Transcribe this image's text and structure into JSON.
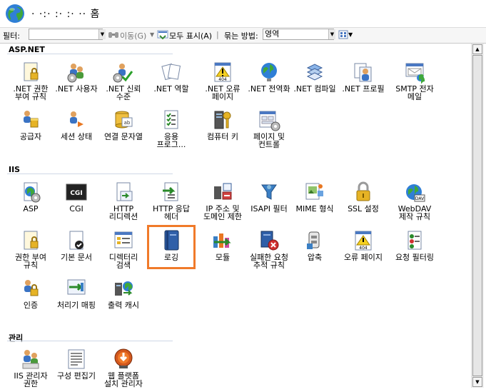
{
  "window": {
    "title": "· ·:· :· :· ·· 홈"
  },
  "toolbar": {
    "filter_label": "필터:",
    "goto_label": "이동(G)",
    "show_all_label": "모두 표시(A)",
    "group_by_label": "묶는 방법:",
    "group_by_value": "영역"
  },
  "sections": [
    {
      "title": "ASP.NET",
      "items": [
        {
          "label": ".NET 권한\n부여 규칙",
          "icon": "net-authorization-icon"
        },
        {
          "label": ".NET 사용자",
          "icon": "net-users-icon"
        },
        {
          "label": ".NET 신뢰\n수준",
          "icon": "net-trust-icon"
        },
        {
          "label": ".NET 역할",
          "icon": "net-roles-icon"
        },
        {
          "label": ".NET 오류\n페이지",
          "icon": "net-error-pages-icon"
        },
        {
          "label": ".NET 전역화",
          "icon": "net-globalization-icon"
        },
        {
          "label": ".NET 컴파일",
          "icon": "net-compilation-icon"
        },
        {
          "label": ".NET 프로필",
          "icon": "net-profile-icon"
        },
        {
          "label": "SMTP 전자\n메일",
          "icon": "smtp-email-icon"
        },
        {
          "label": "공급자",
          "icon": "providers-icon"
        },
        {
          "label": "세션 상태",
          "icon": "session-state-icon"
        },
        {
          "label": "연결 문자열",
          "icon": "connection-strings-icon"
        },
        {
          "label": "응용\n프로그...",
          "icon": "app-settings-icon"
        },
        {
          "label": "컴퓨터 키",
          "icon": "machine-key-icon"
        },
        {
          "label": "페이지 및\n컨트롤",
          "icon": "pages-controls-icon"
        }
      ]
    },
    {
      "title": "IIS",
      "items": [
        {
          "label": "ASP",
          "icon": "asp-icon"
        },
        {
          "label": "CGI",
          "icon": "cgi-icon"
        },
        {
          "label": "HTTP\n리디렉션",
          "icon": "http-redirect-icon"
        },
        {
          "label": "HTTP 응답\n헤더",
          "icon": "http-response-headers-icon"
        },
        {
          "label": "IP 주소 및\n도메인 제한",
          "icon": "ip-domain-restrictions-icon"
        },
        {
          "label": "ISAPI 필터",
          "icon": "isapi-filters-icon"
        },
        {
          "label": "MIME 형식",
          "icon": "mime-types-icon"
        },
        {
          "label": "SSL 설정",
          "icon": "ssl-settings-icon"
        },
        {
          "label": "WebDAV\n제작 규칙",
          "icon": "webdav-icon"
        },
        {
          "label": "권한 부여\n규칙",
          "icon": "authorization-rules-icon"
        },
        {
          "label": "기본 문서",
          "icon": "default-document-icon"
        },
        {
          "label": "디렉터리\n검색",
          "icon": "directory-browsing-icon"
        },
        {
          "label": "로깅",
          "icon": "logging-icon"
        },
        {
          "label": "모듈",
          "icon": "modules-icon"
        },
        {
          "label": "실패한 요청\n추적 규칙",
          "icon": "failed-request-tracing-icon"
        },
        {
          "label": "압축",
          "icon": "compression-icon"
        },
        {
          "label": "오류 페이지",
          "icon": "error-pages-icon"
        },
        {
          "label": "요청 필터링",
          "icon": "request-filtering-icon"
        },
        {
          "label": "인증",
          "icon": "authentication-icon"
        },
        {
          "label": "처리기 매핑",
          "icon": "handler-mappings-icon"
        },
        {
          "label": "출력 캐시",
          "icon": "output-caching-icon"
        }
      ]
    },
    {
      "title": "관리",
      "items": [
        {
          "label": "IIS 관리자\n권한",
          "icon": "iis-manager-permissions-icon"
        },
        {
          "label": "구성 편집기",
          "icon": "configuration-editor-icon"
        },
        {
          "label": "웹 플랫폼\n설치 관리자",
          "icon": "web-platform-installer-icon"
        }
      ]
    }
  ]
}
